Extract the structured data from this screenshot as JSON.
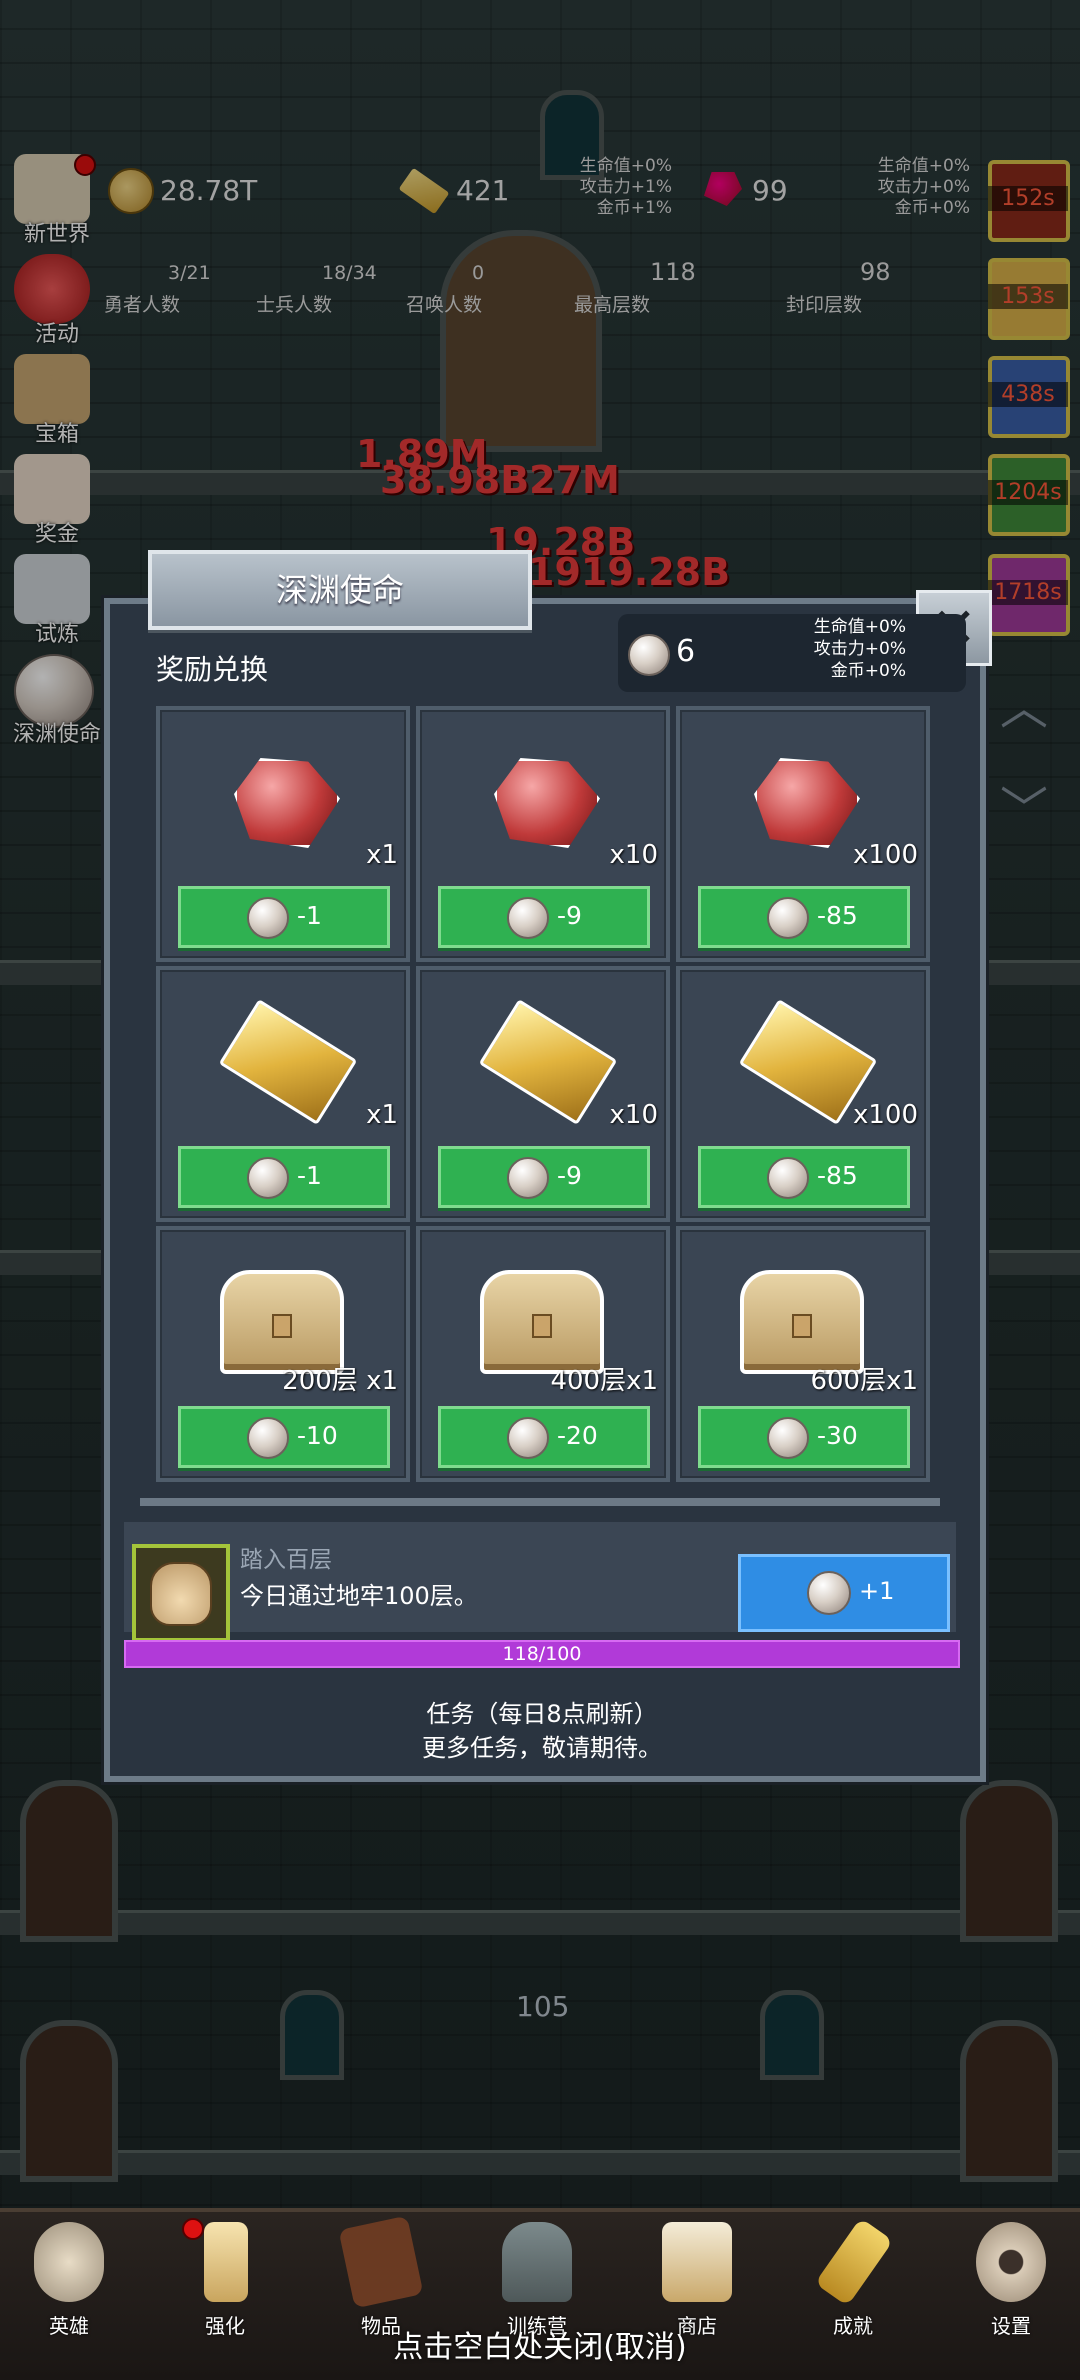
{
  "hud": {
    "coins": "28.78T",
    "gold_bars": "421",
    "gems": "99",
    "bonus_left": [
      "生命值+0%",
      "攻击力+1%",
      "金币+1%"
    ],
    "bonus_right": [
      "生命值+0%",
      "攻击力+0%",
      "金币+0%"
    ],
    "stats": [
      {
        "value": "3/21",
        "label": "勇者人数"
      },
      {
        "value": "18/34",
        "label": "士兵人数"
      },
      {
        "value": "0",
        "label": "召唤人数"
      },
      {
        "value": "118",
        "label": "最高层数"
      },
      {
        "value": "98",
        "label": "封印层数"
      }
    ]
  },
  "side_menu": [
    "新世界",
    "活动",
    "宝箱",
    "奖金",
    "试炼",
    "深渊使命"
  ],
  "timers": [
    "152s",
    "153s",
    "438s",
    "1204s",
    "1718s"
  ],
  "damage_texts": [
    "1.89M",
    "38.98B27M",
    "19.28B",
    "1919.28B"
  ],
  "floor_number": "105",
  "modal": {
    "title": "深渊使命",
    "section_title": "奖励兑换",
    "pearl_count": "6",
    "bonus": [
      "生命值+0%",
      "攻击力+0%",
      "金币+0%"
    ],
    "rewards": [
      {
        "item": "gem",
        "qty": "x1",
        "cost": "-1"
      },
      {
        "item": "gem",
        "qty": "x10",
        "cost": "-9"
      },
      {
        "item": "gem",
        "qty": "x100",
        "cost": "-85"
      },
      {
        "item": "gold",
        "qty": "x1",
        "cost": "-1"
      },
      {
        "item": "gold",
        "qty": "x10",
        "cost": "-9"
      },
      {
        "item": "gold",
        "qty": "x100",
        "cost": "-85"
      },
      {
        "item": "chest",
        "qty": "200层 x1",
        "cost": "-10"
      },
      {
        "item": "chest",
        "qty": "400层x1",
        "cost": "-20"
      },
      {
        "item": "chest",
        "qty": "600层x1",
        "cost": "-30"
      }
    ],
    "task": {
      "name": "踏入百层",
      "desc": "今日通过地牢100层。",
      "reward": "+1",
      "progress_text": "118/100",
      "progress": 1.0
    },
    "footnote_1": "任务（每日8点刷新）",
    "footnote_2": "更多任务，敬请期待。"
  },
  "nav": [
    "英雄",
    "强化",
    "物品",
    "训练营",
    "商店",
    "成就",
    "设置"
  ],
  "close_hint": "点击空白处关闭(取消)"
}
